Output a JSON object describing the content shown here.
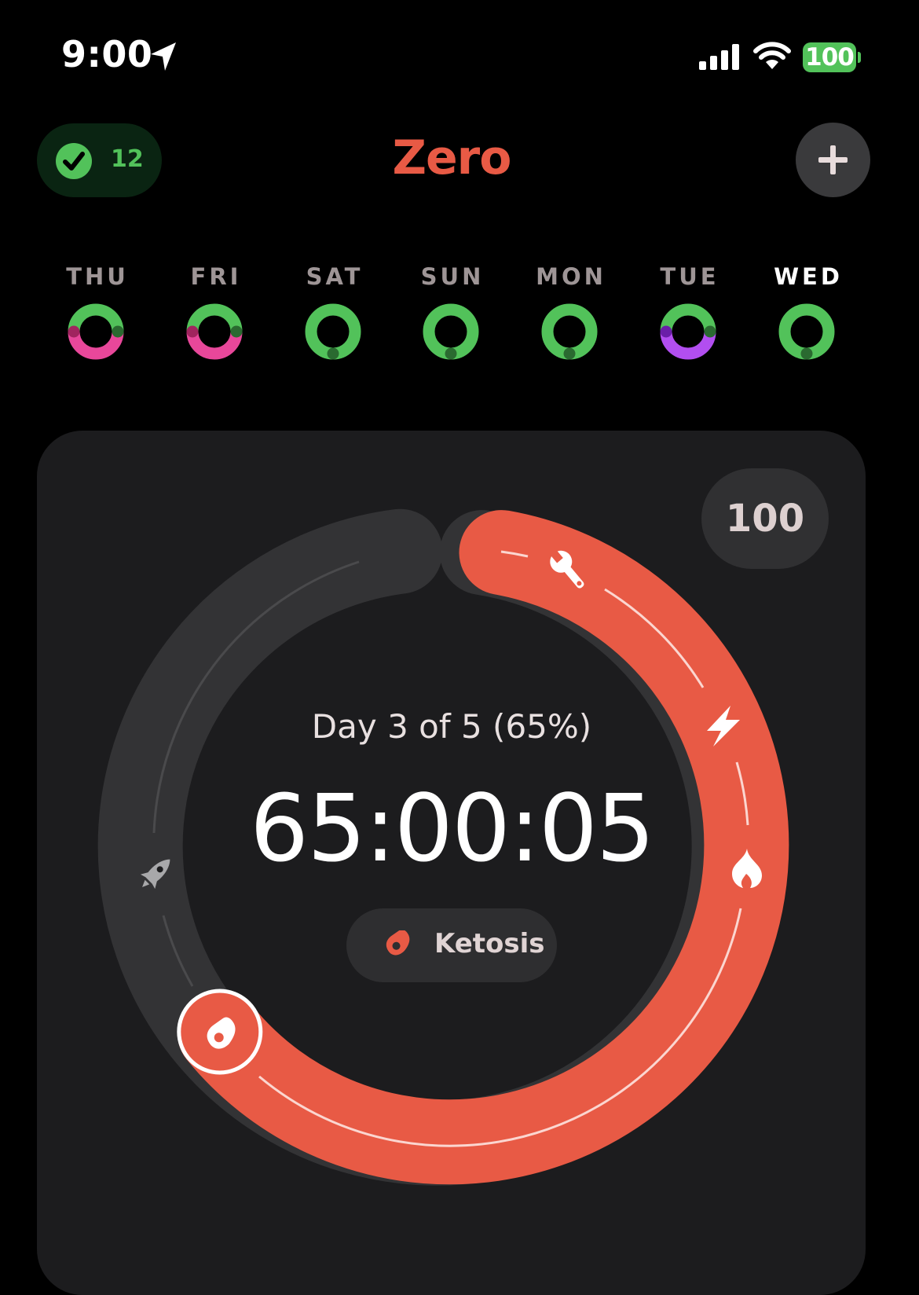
{
  "status_bar": {
    "time": "9:00",
    "battery": "100"
  },
  "header": {
    "streak_count": "12",
    "title": "Zero"
  },
  "week": [
    {
      "label": "THU",
      "today": false
    },
    {
      "label": "FRI",
      "today": false
    },
    {
      "label": "SAT",
      "today": false
    },
    {
      "label": "SUN",
      "today": false
    },
    {
      "label": "MON",
      "today": false
    },
    {
      "label": "TUE",
      "today": false
    },
    {
      "label": "WED",
      "today": true
    }
  ],
  "card": {
    "score": "100",
    "day_progress": "Day 3 of 5 (65%)",
    "timer": "65:00:05",
    "zone_label": "Ketosis",
    "progress_fraction": 0.65
  },
  "colors": {
    "background": "#000000",
    "card": "#1c1c1e",
    "accent": "#e85a45",
    "green": "#52c25a",
    "pink": "#e8479a",
    "purple": "#b24ef0",
    "track": "#333335"
  },
  "icons": {
    "location": "location-arrow-icon",
    "signal": "cellular-signal-icon",
    "wifi": "wifi-icon",
    "streak": "checkmark-icon",
    "add": "plus-icon",
    "wrench": "wrench-icon",
    "lightning": "lightning-icon",
    "flame": "flame-icon",
    "rocket": "rocket-icon",
    "ketosis": "ketosis-icon"
  }
}
